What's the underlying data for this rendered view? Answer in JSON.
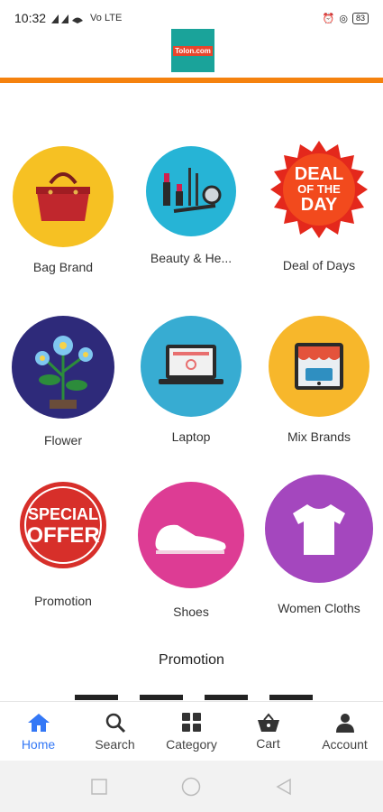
{
  "status": {
    "time": "10:32",
    "network": "Vo LTE",
    "battery": "83"
  },
  "header": {
    "logo_text": "Tolon.com"
  },
  "categories": [
    {
      "label": "Bag Brand",
      "icon": "handbag-icon"
    },
    {
      "label": "Beauty & He...",
      "icon": "cosmetics-icon"
    },
    {
      "label": "Deal of Days",
      "icon": "deal-of-the-day-badge"
    },
    {
      "label": "Flower",
      "icon": "flower-icon"
    },
    {
      "label": "Laptop",
      "icon": "laptop-icon"
    },
    {
      "label": "Mix Brands",
      "icon": "storefront-icon"
    },
    {
      "label": "Promotion",
      "icon": "special-offer-badge"
    },
    {
      "label": "Shoes",
      "icon": "shoe-icon"
    },
    {
      "label": "Women Cloths",
      "icon": "tshirt-icon"
    }
  ],
  "badges": {
    "deal": [
      "DEAL",
      "OF THE",
      "DAY"
    ],
    "offer": [
      "SPECIAL",
      "OFFER"
    ]
  },
  "section": {
    "title": "Promotion"
  },
  "nav": [
    {
      "label": "Home",
      "icon": "home-icon",
      "active": true
    },
    {
      "label": "Search",
      "icon": "search-icon"
    },
    {
      "label": "Category",
      "icon": "grid-icon"
    },
    {
      "label": "Cart",
      "icon": "basket-icon"
    },
    {
      "label": "Account",
      "icon": "person-icon"
    }
  ],
  "colors": {
    "accent": "#f5820e",
    "active": "#3478f6"
  }
}
